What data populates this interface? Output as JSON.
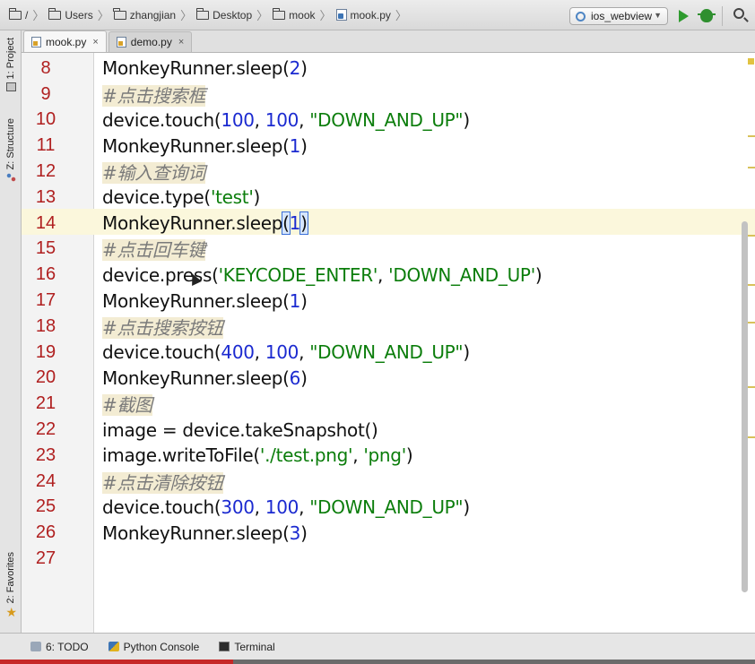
{
  "breadcrumb": {
    "items": [
      {
        "label": "/",
        "icon": "folder-icon"
      },
      {
        "label": "Users",
        "icon": "folder-icon"
      },
      {
        "label": "zhangjian",
        "icon": "folder-icon"
      },
      {
        "label": "Desktop",
        "icon": "folder-icon"
      },
      {
        "label": "mook",
        "icon": "folder-icon"
      },
      {
        "label": "mook.py",
        "icon": "python-file-icon"
      }
    ]
  },
  "toolbar": {
    "run_config": "ios_webview",
    "run_icon": "play-icon",
    "debug_icon": "bug-icon",
    "search_icon": "search-icon"
  },
  "left_tools": {
    "project": "1: Project",
    "structure": "Z: Structure",
    "favorites": "2: Favorites"
  },
  "tabs": [
    {
      "label": "mook.py",
      "close": "×",
      "active": true
    },
    {
      "label": "demo.py",
      "close": "×",
      "active": false
    }
  ],
  "editor": {
    "current_line": 14,
    "lines": [
      {
        "n": "8",
        "parts": [
          [
            "MonkeyRunner.sleep(",
            "t"
          ],
          [
            "2",
            "num"
          ],
          [
            ")",
            "t"
          ]
        ]
      },
      {
        "n": "9",
        "parts": [
          [
            "#点击搜索框",
            "cmt"
          ]
        ]
      },
      {
        "n": "10",
        "parts": [
          [
            "device.touch(",
            "t"
          ],
          [
            "100",
            "num"
          ],
          [
            ", ",
            "t"
          ],
          [
            "100",
            "num"
          ],
          [
            ", ",
            "t"
          ],
          [
            "\"DOWN_AND_UP\"",
            "str"
          ],
          [
            ")",
            "t"
          ]
        ]
      },
      {
        "n": "11",
        "parts": [
          [
            "MonkeyRunner.sleep(",
            "t"
          ],
          [
            "1",
            "num"
          ],
          [
            ")",
            "t"
          ]
        ]
      },
      {
        "n": "12",
        "parts": [
          [
            "#输入查询词",
            "cmt"
          ]
        ]
      },
      {
        "n": "13",
        "parts": [
          [
            "device.type(",
            "t"
          ],
          [
            "'test'",
            "str"
          ],
          [
            ")",
            "t"
          ]
        ]
      },
      {
        "n": "14",
        "parts": [
          [
            "MonkeyRunner.sleep",
            "t"
          ],
          [
            "(",
            "caret"
          ],
          [
            "1",
            "num"
          ],
          [
            ")",
            "caret"
          ]
        ]
      },
      {
        "n": "15",
        "parts": [
          [
            "#点击回车键",
            "cmt"
          ]
        ]
      },
      {
        "n": "16",
        "parts": [
          [
            "device.press(",
            "t"
          ],
          [
            "'KEYCODE_ENTER'",
            "str"
          ],
          [
            ", ",
            "t"
          ],
          [
            "'DOWN_AND_UP'",
            "str"
          ],
          [
            ")",
            "t"
          ]
        ]
      },
      {
        "n": "17",
        "parts": [
          [
            "MonkeyRunner.sleep(",
            "t"
          ],
          [
            "1",
            "num"
          ],
          [
            ")",
            "t"
          ]
        ]
      },
      {
        "n": "18",
        "parts": [
          [
            "#点击搜索按钮",
            "cmt"
          ]
        ]
      },
      {
        "n": "19",
        "parts": [
          [
            "device.touch(",
            "t"
          ],
          [
            "400",
            "num"
          ],
          [
            ", ",
            "t"
          ],
          [
            "100",
            "num"
          ],
          [
            ", ",
            "t"
          ],
          [
            "\"DOWN_AND_UP\"",
            "str"
          ],
          [
            ")",
            "t"
          ]
        ]
      },
      {
        "n": "20",
        "parts": [
          [
            "MonkeyRunner.sleep(",
            "t"
          ],
          [
            "6",
            "num"
          ],
          [
            ")",
            "t"
          ]
        ]
      },
      {
        "n": "21",
        "parts": [
          [
            "#截图",
            "cmt"
          ]
        ]
      },
      {
        "n": "22",
        "parts": [
          [
            "image = device.takeSnapshot()",
            "t"
          ]
        ]
      },
      {
        "n": "23",
        "parts": [
          [
            "image.writeToFile(",
            "t"
          ],
          [
            "'./test.png'",
            "str"
          ],
          [
            ", ",
            "t"
          ],
          [
            "'png'",
            "str"
          ],
          [
            ")",
            "t"
          ]
        ]
      },
      {
        "n": "24",
        "parts": [
          [
            "#点击清除按钮",
            "cmt"
          ]
        ]
      },
      {
        "n": "25",
        "parts": [
          [
            "device.touch(",
            "t"
          ],
          [
            "300",
            "num"
          ],
          [
            ", ",
            "t"
          ],
          [
            "100",
            "num"
          ],
          [
            ", ",
            "t"
          ],
          [
            "\"DOWN_AND_UP\"",
            "str"
          ],
          [
            ")",
            "t"
          ]
        ]
      },
      {
        "n": "26",
        "parts": [
          [
            "MonkeyRunner.sleep(",
            "t"
          ],
          [
            "3",
            "num"
          ],
          [
            ")",
            "t"
          ]
        ]
      },
      {
        "n": "27",
        "parts": []
      }
    ]
  },
  "bottom_tools": [
    {
      "label": "6: TODO",
      "icon": "todo-icon"
    },
    {
      "label": "Python Console",
      "icon": "python-console-icon"
    },
    {
      "label": "Terminal",
      "icon": "terminal-icon"
    }
  ],
  "colors": {
    "line_number": "#b02020",
    "number": "#1b2ad0",
    "string": "#0b7d0b",
    "comment_bg": "#f3ecd3",
    "current_line_bg": "#fbf7dc"
  }
}
